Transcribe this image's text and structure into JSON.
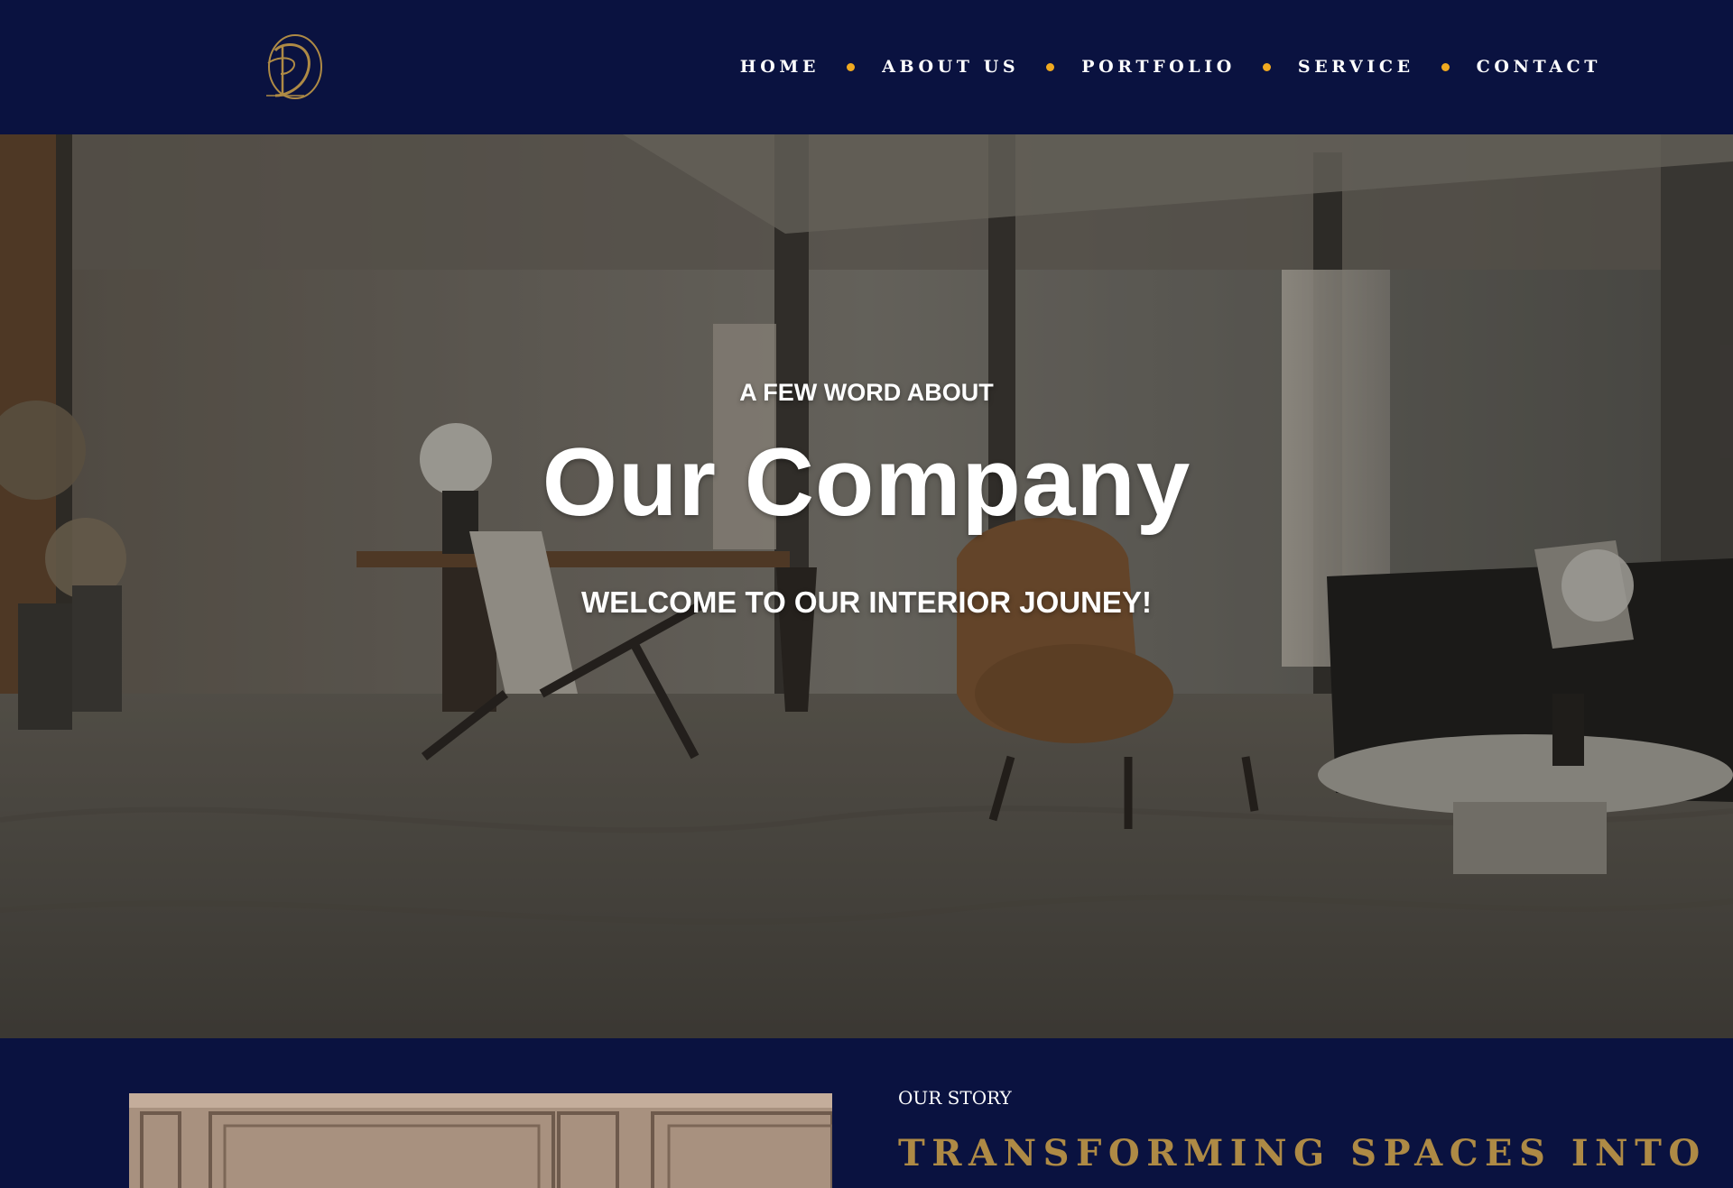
{
  "colors": {
    "navy": "#0a1240",
    "gold": "#ae8a45",
    "nav_dot": "#f0a920",
    "white": "#ffffff"
  },
  "header": {
    "logo_icon": "pd-monogram-logo",
    "nav": [
      {
        "label": "HOME"
      },
      {
        "label": "ABOUT US"
      },
      {
        "label": "PORTFOLIO"
      },
      {
        "label": "SERVICE"
      },
      {
        "label": "CONTACT"
      }
    ]
  },
  "hero": {
    "kicker": "A FEW WORD ABOUT",
    "title": "Our Company",
    "subtitle": "WELCOME TO OUR INTERIOR JOUNEY!",
    "image_icon": "interior-office-photo"
  },
  "story": {
    "kicker": "OUR STORY",
    "heading": "TRANSFORMING SPACES INTO",
    "image_icon": "paneled-wall-photo"
  }
}
